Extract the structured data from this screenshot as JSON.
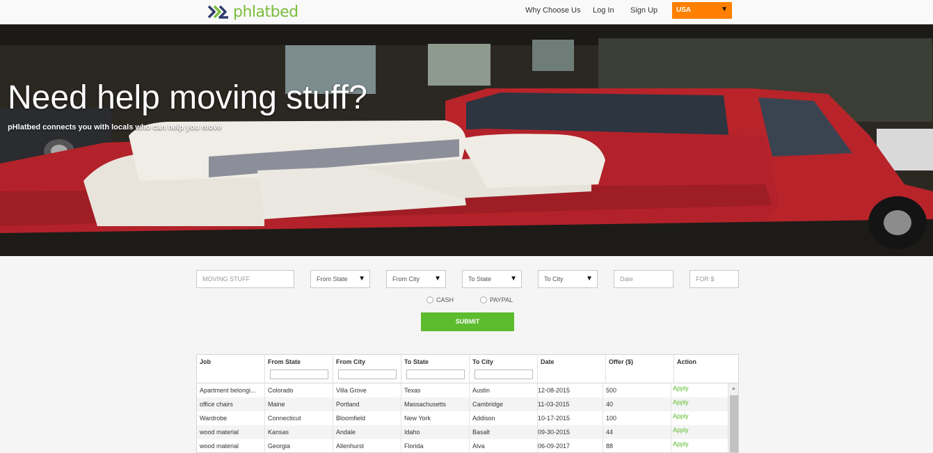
{
  "nav": {
    "logo_text": "phlatbed",
    "links": [
      "Why Choose Us",
      "Log In",
      "Sign Up"
    ],
    "country": "USA"
  },
  "hero": {
    "headline": "Need help moving stuff?",
    "subline": "pHlatbed connects you with locals who can help you move"
  },
  "form": {
    "item_placeholder": "MOVING STUFF",
    "from_state": "From State",
    "from_city": "From City",
    "to_state": "To State",
    "to_city": "To City",
    "date_placeholder": "Date",
    "price_placeholder": "FOR $",
    "payment_options": [
      "CASH",
      "PAYPAL"
    ],
    "submit_label": "SUBMIT"
  },
  "table": {
    "headers": [
      "Job",
      "From State",
      "From City",
      "To State",
      "To City",
      "Date",
      "Offer ($)",
      "Action"
    ],
    "rows": [
      [
        "Apartment belongi...",
        "Colorado",
        "Villa Grove",
        "Texas",
        "Austin",
        "12-08-2015",
        "500",
        "Apply"
      ],
      [
        "office chairs",
        "Maine",
        "Portland",
        "Massachusetts",
        "Cambridge",
        "11-03-2015",
        "40",
        "Apply"
      ],
      [
        "Wardrobe",
        "Connecticut",
        "Bloomfield",
        "New York",
        "Addison",
        "10-17-2015",
        "100",
        "Apply"
      ],
      [
        "wood material",
        "Kansas",
        "Andale",
        "Idaho",
        "Basalt",
        "09-30-2015",
        "44",
        "Apply"
      ],
      [
        "wood material",
        "Georgia",
        "Allenhurst",
        "Florida",
        "Alva",
        "06-09-2017",
        "88",
        "Apply"
      ]
    ]
  },
  "colors": {
    "accent_green": "#5dbb2e",
    "country_orange": "#ff8000",
    "truck_red": "#b8242a"
  },
  "icons": {
    "logo": "phlatbed-logo-icon",
    "caret": "caret-down-icon",
    "scroll_up": "scroll-up-icon"
  }
}
